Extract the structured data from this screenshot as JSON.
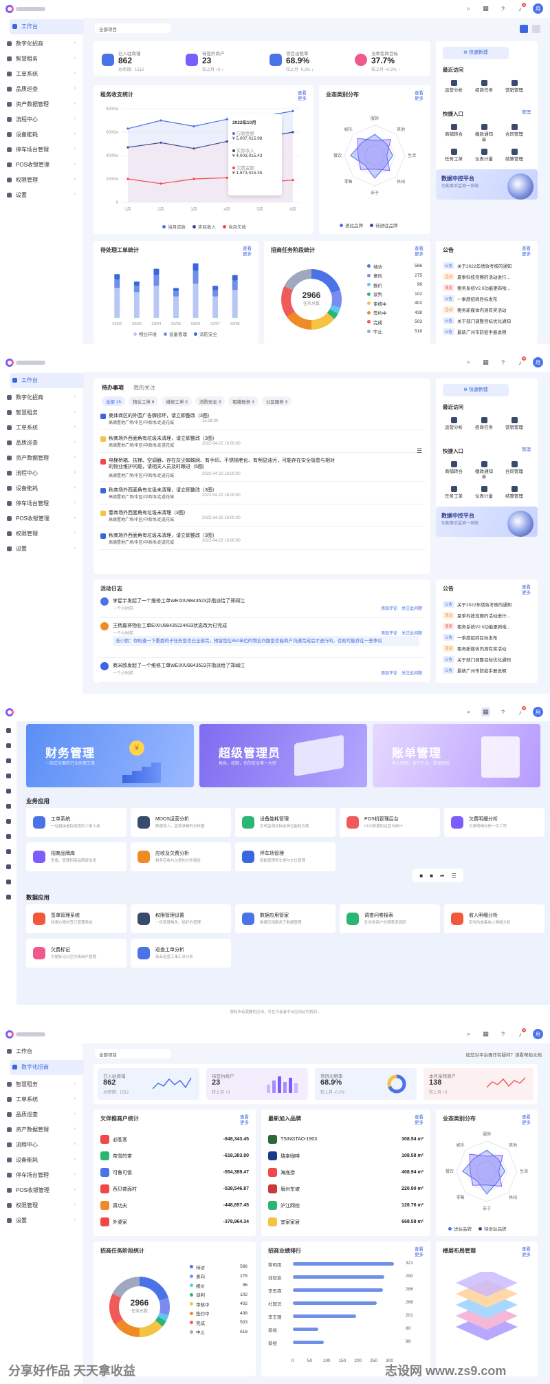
{
  "menu": [
    "工作台",
    "数字化招商",
    "智慧租务",
    "工单系统",
    "品质巡查",
    "资产数据管理",
    "流程中心",
    "设备能耗",
    "停车场台管理",
    "POS收银管理",
    "权限管理",
    "设置"
  ],
  "topbar": {
    "badge": "8",
    "avatar": "用"
  },
  "s1": {
    "select": "全部项目",
    "kpis": [
      {
        "label": "已入驻商铺",
        "value": "862",
        "sub": "总商铺：1512",
        "color": "#4a73e8"
      },
      {
        "label": "待签约商户",
        "value": "23",
        "sub": "较上月 +3",
        "trend": "↑",
        "color": "#7a5cff"
      },
      {
        "label": "项目出租率",
        "value": "68.9%",
        "sub": "较上月 -0.2%",
        "trend": "↓",
        "color": "#4a73e8"
      },
      {
        "label": "当季招商目标",
        "value": "37.7%",
        "sub": "较上月 +0.2%",
        "trend": "↑",
        "color": "#f05a8a"
      }
    ],
    "quick_btn": "快速新建",
    "recent_title": "最近访问",
    "recent": [
      "运营分析",
      "招商任务",
      "营销管理"
    ],
    "quick_title": "快捷入口",
    "quick_more": "管理",
    "quick": [
      "商铺转合",
      "缴款通知单",
      "合同管理",
      "任务工单",
      "仪表计量",
      "结算管理"
    ],
    "promo": {
      "title": "数据中控平台",
      "sub": "功能事后监测一系统"
    },
    "revenue": {
      "title": "租务收支统计",
      "more": "查看更多",
      "tip_title": "2022年10月",
      "tip": [
        {
          "label": "应收金额",
          "value": "¥ 5,007,015.98"
        },
        {
          "label": "实际收入",
          "value": "¥ 4,003,015.43"
        },
        {
          "label": "欠费金额",
          "value": "¥ 1,873,015.35"
        }
      ],
      "legend": [
        "当月应收",
        "实际收入",
        "当月欠收"
      ]
    },
    "radar": {
      "title": "业态类别分布",
      "more": "查看更多",
      "axes": [
        "服饰",
        "其他",
        "生活",
        "休闲",
        "亲子",
        "零售",
        "餐饮",
        "娱乐"
      ],
      "legend": [
        "进驻品牌",
        "待进驻品牌"
      ]
    },
    "workorders": {
      "title": "待处理工单统计",
      "more": "查看更多",
      "legend": [
        "物业环境",
        "设备管理",
        "消防安全"
      ]
    },
    "stages": {
      "title": "招商任务阶段统计",
      "more": "查看更多",
      "center_value": "2966",
      "center_label": "任务总数",
      "items": [
        {
          "name": "待访",
          "value": "586",
          "color": "#4a73e8"
        },
        {
          "name": "意向",
          "value": "275",
          "color": "#7a8cf0"
        },
        {
          "name": "报价",
          "value": "96",
          "color": "#5cc8f0"
        },
        {
          "name": "谈判",
          "value": "102",
          "color": "#2bb673"
        },
        {
          "name": "审核中",
          "value": "402",
          "color": "#f5c242"
        },
        {
          "name": "签约中",
          "value": "438",
          "color": "#f08a24"
        },
        {
          "name": "完成",
          "value": "503",
          "color": "#f05a5a"
        },
        {
          "name": "中止",
          "value": "518",
          "color": "#a0a8c0"
        }
      ]
    },
    "notice": {
      "title": "公告",
      "more": "查看更多",
      "items": [
        {
          "tag": "公告",
          "text": "关于2022年绩效考核的通知"
        },
        {
          "tag": "活动",
          "text": "夏季科技竞赛的活动进行..."
        },
        {
          "tag": "消息",
          "text": "租务系统V2.0功能更新啦..."
        },
        {
          "tag": "公告",
          "text": "一季度招商目标发布"
        },
        {
          "tag": "活动",
          "text": "租务新媒体内测有奖活动"
        },
        {
          "tag": "公告",
          "text": "关于部门调整目标优化通知"
        },
        {
          "tag": "公告",
          "text": "最新广州市防疫手册说明"
        }
      ]
    }
  },
  "s2": {
    "tabs": [
      "待办事项",
      "我的关注"
    ],
    "filters": [
      "全部 15",
      "物业工单 8",
      "维修工单 3",
      "消防安全 3",
      "租缴账务 3",
      "公区服务 3"
    ],
    "todos": [
      {
        "title": "奥体商区的外围广告牌损坏，请立即整改（3图）",
        "addr": "高德置地广场/中区/中商场/走道花城",
        "time": "15:28:00",
        "color": "#3a66e0"
      },
      {
        "title": "秋商场外西面角有垃圾未清理，请立即整改（3图）",
        "addr": "高德置地广场/中区/中商场/走道花城",
        "time": "2022-04-22 16:00:00",
        "color": "#f5c242"
      },
      {
        "title": "电梯桥箱、扶梯、空调器、存在灰尘蜘蛛网、有手印、不锈钢老化、有明显油污，可能存在安全隐患与相对的物业维护问题，请相关人员及时跟进（5图）",
        "addr": "高德置地广场/中区/中商场/走道花城",
        "time": "2022-04-22 16:00:00",
        "color": "#f04848"
      },
      {
        "title": "秋商场外西面角有垃圾未清理，请立即整改（3图）",
        "addr": "高德置地广场/中区/中商场/走道花城",
        "time": "2022-04-22 16:00:00",
        "color": "#3a66e0"
      },
      {
        "title": "春商场外西面角有垃圾未清理（3图）",
        "addr": "高德置地广场/中区/中商场/走道花城",
        "time": "2022-04-22 16:00:00",
        "color": "#f5c242"
      },
      {
        "title": "秋商场外西面角有垃圾未清理，请立即整改（3图）",
        "addr": "高德置地广场/中区/中商场/走道花城",
        "time": "2022-04-22 16:00:00",
        "color": "#3a66e0"
      }
    ],
    "log": {
      "title": "活动日志",
      "items": [
        {
          "text": "李星宇发起了一个维修工单WEIXIU9843523并指派给了郑闻江",
          "time": "一个小时前",
          "ops": "添加评论　关注此问题"
        },
        {
          "text": "王杨嘉将物业工单EIXIU98435224433状态改为已完成",
          "time": "一个小时前",
          "ops": "添加评论　关注此问题",
          "reply": "洗小丽：你检查一下重面的子任务是否已全部完，预留是在850单位的物业问题是否能商户沟通完成后才进行的，否则可能存在一些争议"
        },
        {
          "text": "商米欧发起了一个维修工单WEIXIU9843523并指派给了郑闻江",
          "time": "一个小时前",
          "ops": "添加评论　关注此问题"
        }
      ]
    }
  },
  "s3": {
    "banners": [
      {
        "title": "财务管理",
        "sub": "一站式全面的行业助理工具"
      },
      {
        "title": "超级管理员",
        "sub": "角色、权限，你的安全第一大师"
      },
      {
        "title": "账单管理",
        "sub": "收入明细，便于汇总，数据高效"
      }
    ],
    "biz_title": "业务应用",
    "biz": [
      {
        "name": "工单系统",
        "desc": "一站超级追踪进度的工单工具",
        "color": "#4a73e8"
      },
      {
        "name": "MDOS运营分析",
        "desc": "数据导入，直观准确的分析图",
        "color": "#3a4a6b"
      },
      {
        "name": "设备能耗管理",
        "desc": "实时监测并标定商位能耗方案",
        "color": "#2bb673"
      },
      {
        "name": "POS机管理后台",
        "desc": "POS数据的运营与统计",
        "color": "#f05a5a"
      },
      {
        "name": "欠费明细分析",
        "desc": "欠费明细分析一目了然",
        "color": "#7a5cff"
      },
      {
        "name": "招商品牌库",
        "desc": "查看、管理招商品牌库信息",
        "color": "#7a5cff"
      },
      {
        "name": "应收及欠费分析",
        "desc": "租务应收与欠费的分析报告",
        "color": "#f08a24"
      },
      {
        "name": "停车场管理",
        "desc": "智能管理停车场与车位管理",
        "color": "#3a66e0"
      }
    ],
    "data_title": "数据应用",
    "data": [
      {
        "name": "签单管理系统",
        "desc": "快速方便的签订管理系统",
        "color": "#f05a3a"
      },
      {
        "name": "权限管理设置",
        "desc": "一目暂理角色、组织的管理",
        "color": "#3a4a6b"
      },
      {
        "name": "数据应用管家",
        "desc": "数据应用服务于数据管理",
        "color": "#4a73e8"
      },
      {
        "name": "调查问卷报表",
        "desc": "针对各商户的满意度调研",
        "color": "#2bb673"
      },
      {
        "name": "收入明细分析",
        "desc": "实时的收集收入明细分析",
        "color": "#f05a3a"
      },
      {
        "name": "欠费标记",
        "desc": "方便标记以空欠费商户管理",
        "color": "#f05a8a"
      },
      {
        "name": "巡查工单分析",
        "desc": "商业巡查工单汇总分析",
        "color": "#4a73e8"
      }
    ],
    "footer": "版权所有需要的应用，可在可者者中台应用站内找到..."
  },
  "s4": {
    "select": "全部项目",
    "help": "如您对平台操作有疑问？请看帮助文档",
    "kpis": [
      {
        "label": "已入驻商铺",
        "value": "862",
        "sub": "总商铺：1512"
      },
      {
        "label": "待签约商户",
        "value": "23",
        "sub": "较上月 +3"
      },
      {
        "label": "项目出租率",
        "value": "68.9%",
        "sub": "较上月 -0.2%"
      },
      {
        "label": "本月采拜商户",
        "value": "138",
        "sub": "较上月 +3"
      }
    ],
    "arrears": {
      "title": "欠伴推商户统计",
      "more": "查看更多",
      "items": [
        {
          "name": "必胜客",
          "value": "-848,343.45",
          "color": "#f04848"
        },
        {
          "name": "奈雪的茶",
          "value": "-618,383.90",
          "color": "#2bb673"
        },
        {
          "name": "可鲁可饭",
          "value": "-554,389.47",
          "color": "#4a73e8"
        },
        {
          "name": "西贝莜面村",
          "value": "-538,546.87",
          "color": "#f04848"
        },
        {
          "name": "真功夫",
          "value": "-448,657.45",
          "color": "#f08a24"
        },
        {
          "name": "外婆家",
          "value": "-378,964.34",
          "color": "#f04848"
        }
      ]
    },
    "newbrands": {
      "title": "最新加入品牌",
      "more": "查看更多",
      "items": [
        {
          "name": "TSINGTAO-1903",
          "value": "308.54 m²",
          "color": "#2a6a3a"
        },
        {
          "name": "瑞幸咖啡",
          "value": "108.58 m²",
          "color": "#1a3a8a"
        },
        {
          "name": "海底捞",
          "value": "408.94 m²",
          "color": "#f04848"
        },
        {
          "name": "眉州东坡",
          "value": "220.90 m²",
          "color": "#c83a3a"
        },
        {
          "name": "沪江网校",
          "value": "128.76 m²",
          "color": "#2bb673"
        },
        {
          "name": "宜家家居",
          "value": "668.58 m²",
          "color": "#f5c242"
        }
      ]
    },
    "radar": {
      "title": "业态类别分布",
      "more": "查看更多",
      "axes": [
        "服饰",
        "其他",
        "生活",
        "休闲",
        "亲子",
        "零售",
        "餐饮",
        "娱乐"
      ],
      "legend": [
        "进驻品牌",
        "待进驻品牌"
      ]
    },
    "stages": {
      "title": "招商任务阶段统计",
      "center_value": "2966",
      "center_label": "任务总数"
    },
    "ranking": {
      "title": "招商业绩排行",
      "more": "查看更多",
      "items": [
        {
          "name": "黎明雨",
          "value": 321
        },
        {
          "name": "钱智宸",
          "value": 290
        },
        {
          "name": "李思霖",
          "value": 286
        },
        {
          "name": "杜国滨",
          "value": 266
        },
        {
          "name": "李玉珊",
          "value": 201
        },
        {
          "name": "蔡绥",
          "value": 80
        },
        {
          "name": "蔡组",
          "value": 99
        }
      ],
      "axis": [
        "0",
        "50",
        "100",
        "150",
        "200",
        "250",
        "300"
      ]
    },
    "floors": {
      "title": "楼层布局管理",
      "more": "查看更多"
    }
  },
  "watermark": {
    "left": "分享好作品 天天拿收益",
    "right": "志设网 www.zs9.com"
  },
  "chart_data": [
    {
      "type": "line",
      "title": "租务收支统计",
      "categories": [
        "1月",
        "2月",
        "3月",
        "4月",
        "5月",
        "6月"
      ],
      "series": [
        {
          "name": "当月应收",
          "values": [
            6300000,
            7000000,
            6500000,
            7100000,
            7300000,
            7800000
          ]
        },
        {
          "name": "实际收入",
          "values": [
            4700000,
            5100000,
            4600000,
            5200000,
            5500000,
            6000000
          ]
        },
        {
          "name": "当月欠收",
          "values": [
            2000000,
            1600000,
            2000000,
            2100000,
            1700000,
            1900000
          ]
        }
      ],
      "ylim": [
        0,
        8000000
      ],
      "ytick_labels": [
        "0",
        "2000w",
        "4000w",
        "6000w",
        "8000w"
      ]
    },
    {
      "type": "bar",
      "title": "待处理工单统计",
      "categories": [
        "03/02",
        "03/03",
        "03/04",
        "03/05",
        "03/06",
        "03/07",
        "03/08"
      ],
      "series": [
        {
          "name": "物业环境",
          "values": [
            28,
            24,
            30,
            20,
            32,
            20,
            26
          ]
        },
        {
          "name": "设备管理",
          "values": [
            8,
            6,
            10,
            5,
            12,
            6,
            9
          ]
        },
        {
          "name": "消防安全",
          "values": [
            5,
            4,
            6,
            3,
            7,
            4,
            5
          ]
        }
      ]
    },
    {
      "type": "pie",
      "title": "招商任务阶段统计",
      "labels": [
        "待访",
        "意向",
        "报价",
        "谈判",
        "审核中",
        "签约中",
        "完成",
        "中止"
      ],
      "values": [
        586,
        275,
        96,
        102,
        402,
        438,
        503,
        518
      ]
    }
  ]
}
